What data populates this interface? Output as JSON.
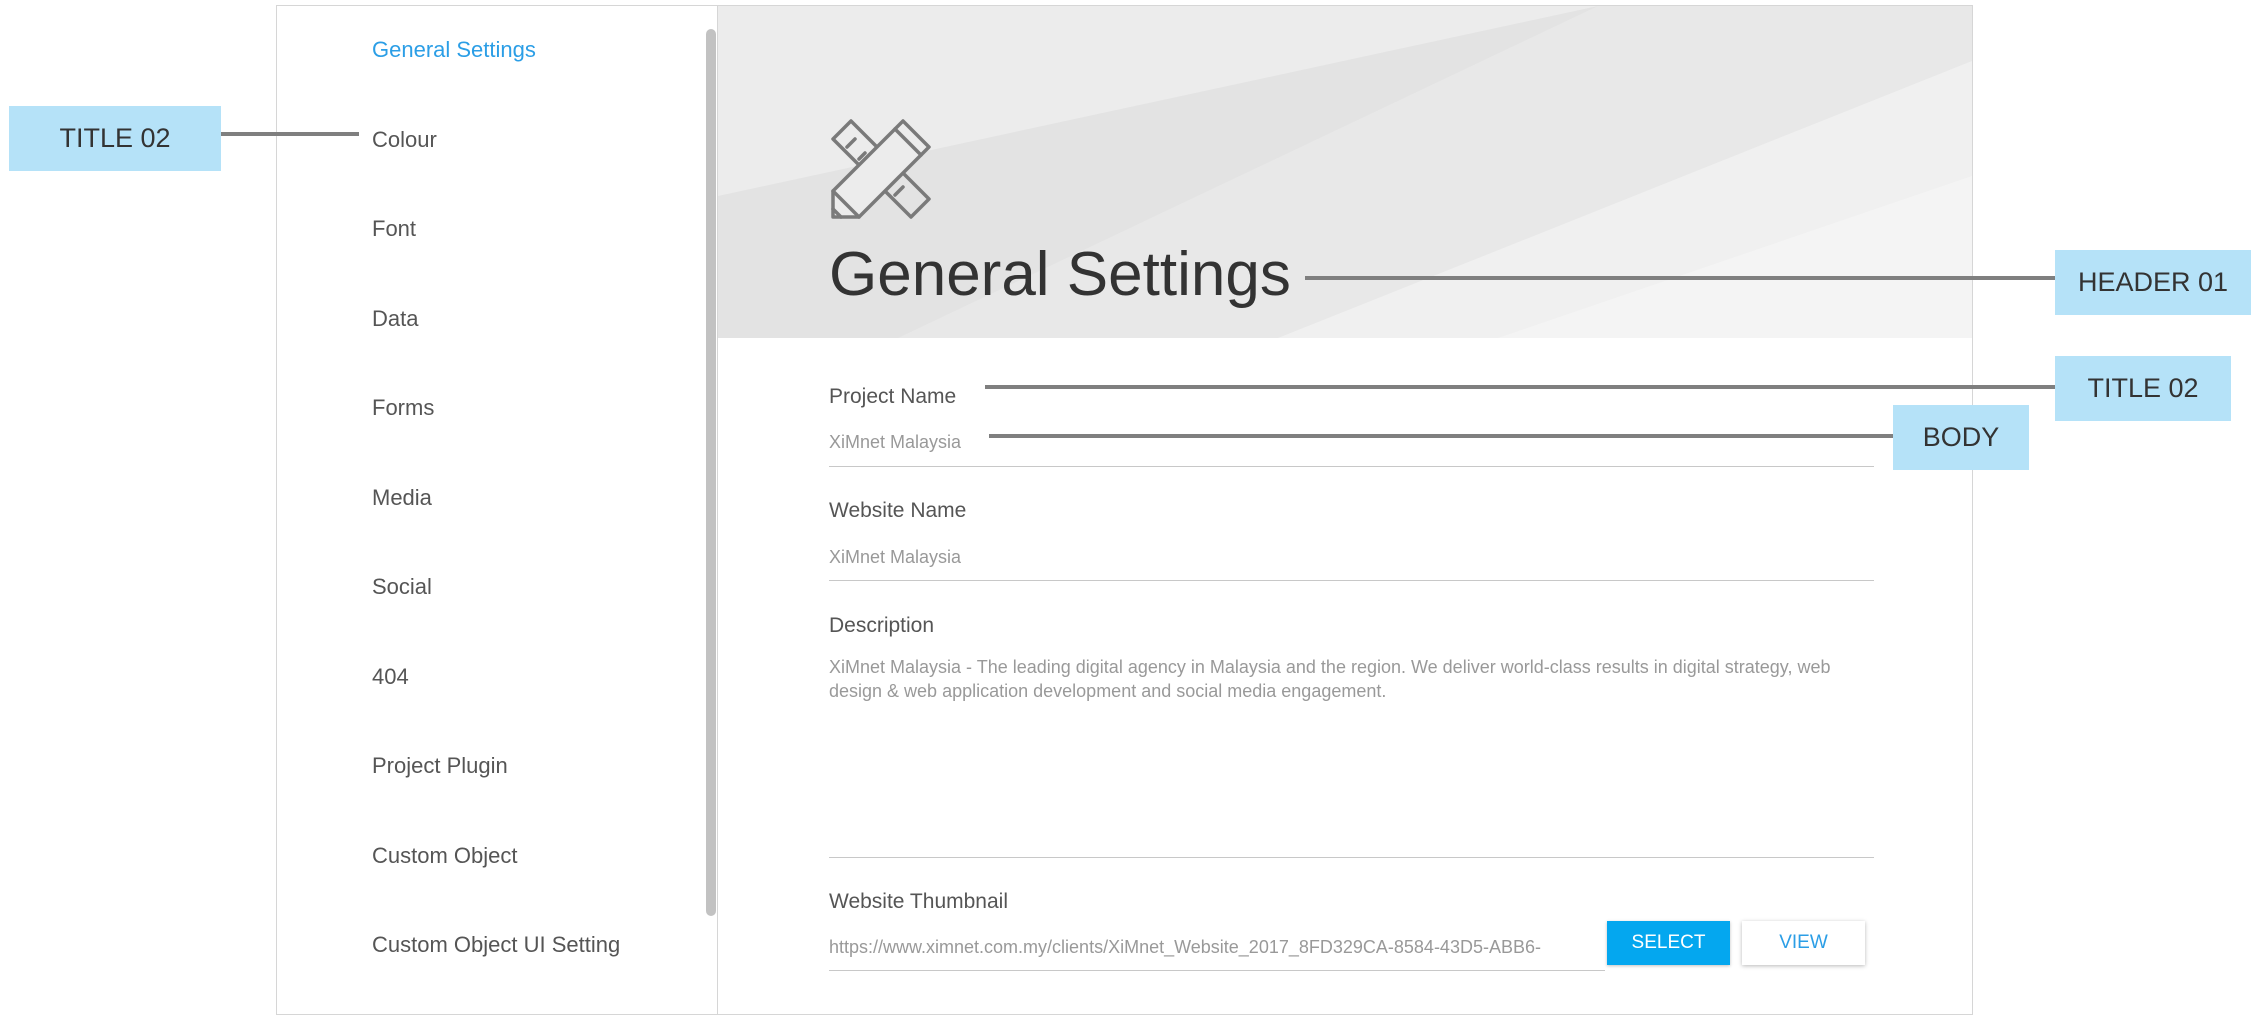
{
  "sidebar": {
    "items": [
      {
        "label": "General Settings",
        "active": true
      },
      {
        "label": "Colour"
      },
      {
        "label": "Font"
      },
      {
        "label": "Data"
      },
      {
        "label": "Forms"
      },
      {
        "label": "Media"
      },
      {
        "label": "Social"
      },
      {
        "label": "404"
      },
      {
        "label": "Project Plugin"
      },
      {
        "label": "Custom Object"
      },
      {
        "label": "Custom Object UI Setting"
      }
    ]
  },
  "header": {
    "icon": "pencil-ruler-icon",
    "title": "General Settings"
  },
  "form": {
    "project_name": {
      "label": "Project Name",
      "value": "XiMnet Malaysia"
    },
    "website_name": {
      "label": "Website Name",
      "value": "XiMnet Malaysia"
    },
    "description": {
      "label": "Description",
      "value": "XiMnet Malaysia - The leading digital agency in Malaysia and the region. We deliver world-class results in digital strategy, web design & web application development and social media engagement."
    },
    "website_thumbnail": {
      "label": "Website Thumbnail",
      "value": "https://www.ximnet.com.my/clients/XiMnet_Website_2017_8FD329CA-8584-43D5-ABB6-",
      "select_label": "SELECT",
      "view_label": "VIEW"
    }
  },
  "annotations": {
    "title02_left": "TITLE 02",
    "header01": "HEADER 01",
    "title02_right": "TITLE 02",
    "body": "BODY"
  },
  "colors": {
    "accent": "#2b9ee6",
    "button_primary": "#04a7ef",
    "callout_bg": "#b5e2f8",
    "leader_line": "#7f7f7f"
  }
}
